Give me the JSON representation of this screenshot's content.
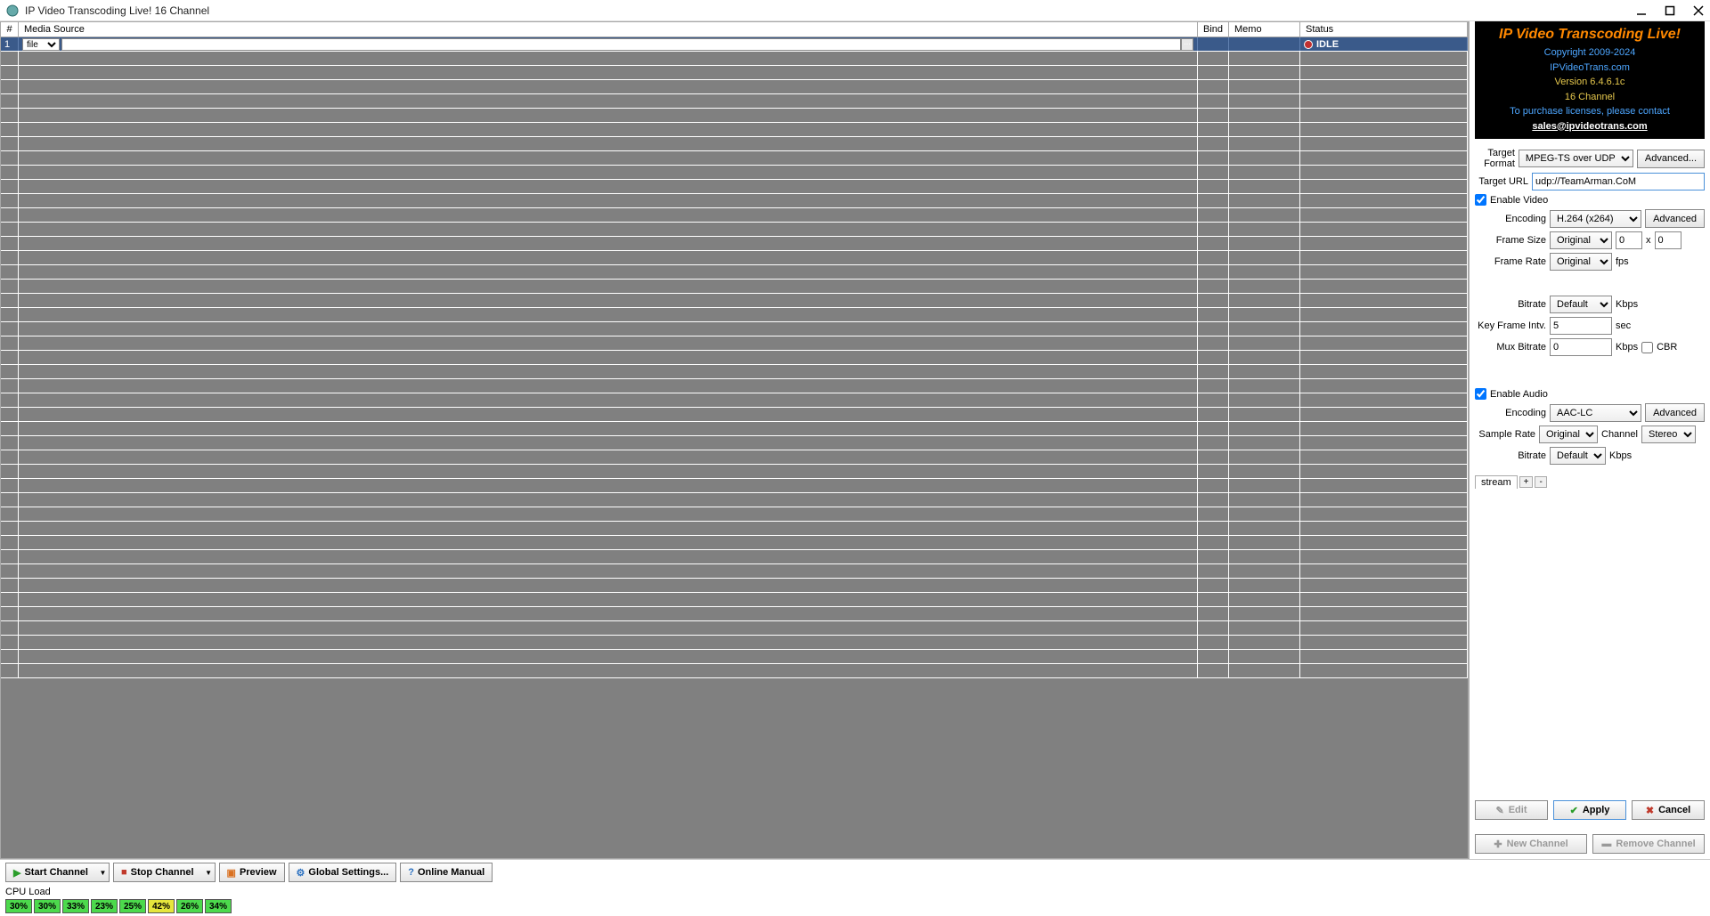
{
  "window": {
    "title": "IP Video Transcoding Live! 16 Channel"
  },
  "table": {
    "headers": {
      "num": "#",
      "source": "Media Source",
      "bind": "Bind",
      "memo": "Memo",
      "status": "Status"
    },
    "row1": {
      "num": "1",
      "source_type": "file",
      "status": "IDLE"
    }
  },
  "brand": {
    "title": "IP Video Transcoding Live!",
    "copyright": "Copyright 2009-2024",
    "site": "IPVideoTrans.com",
    "version": "Version 6.4.6.1c",
    "channels": "16 Channel",
    "purchase": "To purchase licenses, please contact",
    "email": "sales@ipvideotrans.com"
  },
  "form": {
    "target_format_label": "Target Format",
    "target_format_value": "MPEG-TS over UDP",
    "advanced": "Advanced...",
    "target_url_label": "Target URL",
    "target_url_value": "udp://TeamArman.CoM",
    "enable_video": "Enable Video",
    "encoding_label": "Encoding",
    "video_encoding": "H.264 (x264)",
    "advanced2": "Advanced",
    "frame_size_label": "Frame Size",
    "frame_size_value": "Original",
    "frame_w": "0",
    "frame_h": "0",
    "x_sep": "x",
    "frame_rate_label": "Frame Rate",
    "frame_rate_value": "Original",
    "fps": "fps",
    "bitrate_label": "Bitrate",
    "bitrate_value": "Default",
    "kbps": "Kbps",
    "keyframe_label": "Key Frame Intv.",
    "keyframe_value": "5",
    "sec": "sec",
    "mux_label": "Mux Bitrate",
    "mux_value": "0",
    "cbr": "CBR",
    "enable_audio": "Enable Audio",
    "audio_encoding": "AAC-LC",
    "sample_rate_label": "Sample Rate",
    "sample_rate_value": "Original",
    "channel_label": "Channel",
    "channel_value": "Stereo",
    "audio_bitrate_value": "Default",
    "stream_tab": "stream"
  },
  "actions": {
    "edit": "Edit",
    "apply": "Apply",
    "cancel": "Cancel",
    "new_channel": "New Channel",
    "remove_channel": "Remove Channel"
  },
  "toolbar": {
    "start": "Start Channel",
    "stop": "Stop Channel",
    "preview": "Preview",
    "global": "Global Settings...",
    "manual": "Online Manual"
  },
  "cpu": {
    "label": "CPU Load",
    "cores": [
      {
        "v": "30%",
        "c": "c-green"
      },
      {
        "v": "30%",
        "c": "c-green"
      },
      {
        "v": "33%",
        "c": "c-green"
      },
      {
        "v": "23%",
        "c": "c-green"
      },
      {
        "v": "25%",
        "c": "c-green"
      },
      {
        "v": "42%",
        "c": "c-yellow"
      },
      {
        "v": "26%",
        "c": "c-green"
      },
      {
        "v": "34%",
        "c": "c-green"
      }
    ]
  }
}
